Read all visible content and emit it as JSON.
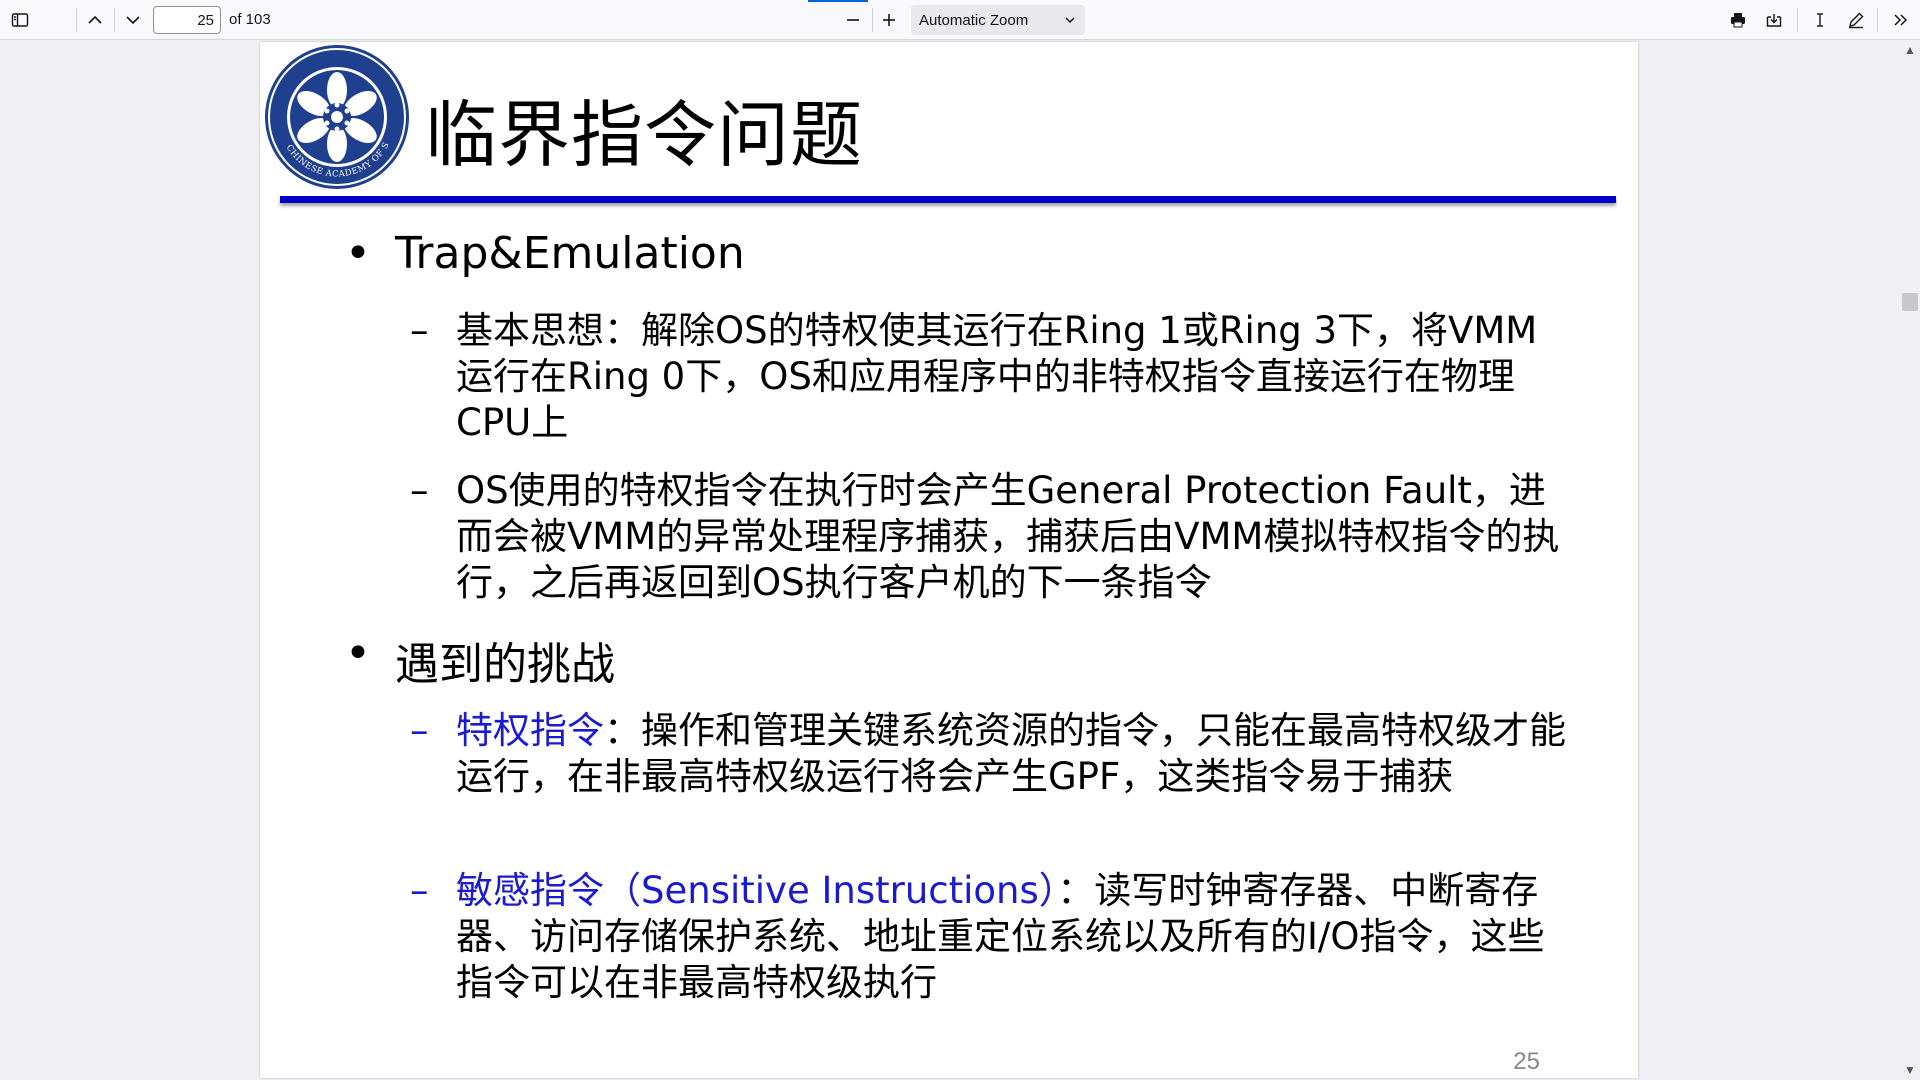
{
  "toolbar": {
    "page_number": "25",
    "page_count": "of 103",
    "zoom_label": "Automatic Zoom",
    "icons": {
      "sidebar": "sidebar-toggle-icon",
      "prev": "chevron-up-icon",
      "next": "chevron-down-icon",
      "zoom_out": "minus-icon",
      "zoom_in": "plus-icon",
      "print": "printer-icon",
      "save": "download-icon",
      "text": "text-cursor-icon",
      "draw": "pen-icon",
      "more": "double-chevron-right-icon"
    },
    "accent_color": "#0060df"
  },
  "slide": {
    "title": "临界指令问题",
    "rule_color": "#0000c8",
    "logo_text": "中国科学院 CHINESE ACADEMY OF SCIENCES",
    "bullets": [
      {
        "symbol": "•",
        "text": "Trap&Emulation",
        "subs": [
          {
            "symbol": "–",
            "text": "基本思想：解除OS的特权使其运行在Ring 1或Ring 3下，将VMM运行在Ring 0下，OS和应用程序中的非特权指令直接运行在物理CPU上"
          },
          {
            "symbol": "–",
            "text": "OS使用的特权指令在执行时会产生General Protection Fault，进而会被VMM的异常处理程序捕获，捕获后由VMM模拟特权指令的执行，之后再返回到OS执行客户机的下一条指令"
          }
        ]
      },
      {
        "symbol": "•",
        "text": "遇到的挑战",
        "subs": [
          {
            "symbol": "–",
            "term": "特权指令",
            "text": "：操作和管理关键系统资源的指令，只能在最高特权级才能运行，在非最高特权级运行将会产生GPF，这类指令易于捕获"
          },
          {
            "symbol": "–",
            "term": "敏感指令（Sensitive Instructions）",
            "text": "：读写时钟寄存器、中断寄存器、访问存储保护系统、地址重定位系统以及所有的I/O指令，这些指令可以在非最高特权级执行"
          }
        ]
      }
    ],
    "term_color": "#1a1ad0",
    "page_number": "25"
  }
}
